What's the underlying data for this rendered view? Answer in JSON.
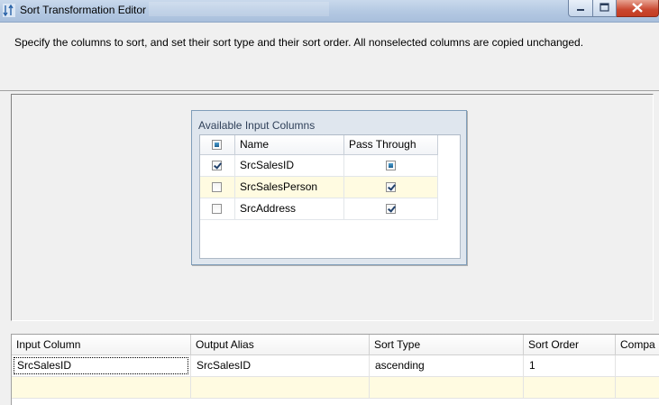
{
  "window": {
    "title": "Sort Transformation Editor"
  },
  "instruction": "Specify the columns to sort, and set their sort type and their sort order. All nonselected columns are copied unchanged.",
  "available_columns": {
    "title": "Available Input Columns",
    "headers": {
      "name": "Name",
      "pass_through": "Pass Through"
    },
    "rows": [
      {
        "name": "SrcSalesID",
        "selected": true,
        "pass_through": "partial"
      },
      {
        "name": "SrcSalesPerson",
        "selected": false,
        "pass_through": "checked"
      },
      {
        "name": "SrcAddress",
        "selected": false,
        "pass_through": "checked"
      }
    ]
  },
  "sort_grid": {
    "headers": {
      "input_column": "Input Column",
      "output_alias": "Output Alias",
      "sort_type": "Sort Type",
      "sort_order": "Sort Order",
      "comparison": "Compa"
    },
    "rows": [
      {
        "input_column": "SrcSalesID",
        "output_alias": "SrcSalesID",
        "sort_type": "ascending",
        "sort_order": "1",
        "comparison": ""
      }
    ]
  },
  "colors": {
    "titlebar": "#b3c8e2",
    "alt_row": "#fffbe1",
    "close_button": "#c9472f"
  }
}
